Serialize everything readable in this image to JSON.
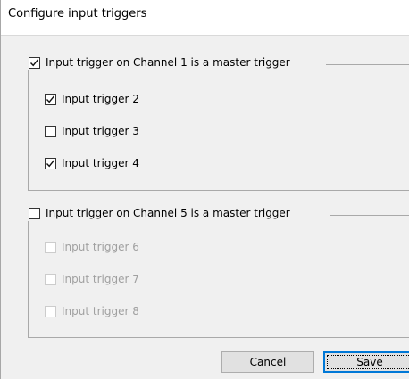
{
  "dialog": {
    "title": "Configure input triggers"
  },
  "group1": {
    "master_label": "Input trigger on Channel 1 is a master trigger",
    "master_checked": true,
    "items": [
      {
        "label": "Input trigger 2",
        "checked": true,
        "enabled": true
      },
      {
        "label": "Input trigger 3",
        "checked": false,
        "enabled": true
      },
      {
        "label": "Input trigger 4",
        "checked": true,
        "enabled": true
      }
    ]
  },
  "group2": {
    "master_label": "Input trigger on Channel 5 is a master trigger",
    "master_checked": false,
    "items": [
      {
        "label": "Input trigger 6",
        "checked": false,
        "enabled": false
      },
      {
        "label": "Input trigger 7",
        "checked": false,
        "enabled": false
      },
      {
        "label": "Input trigger 8",
        "checked": false,
        "enabled": false
      }
    ]
  },
  "buttons": {
    "cancel_label": "Cancel",
    "save_label": "Save"
  }
}
